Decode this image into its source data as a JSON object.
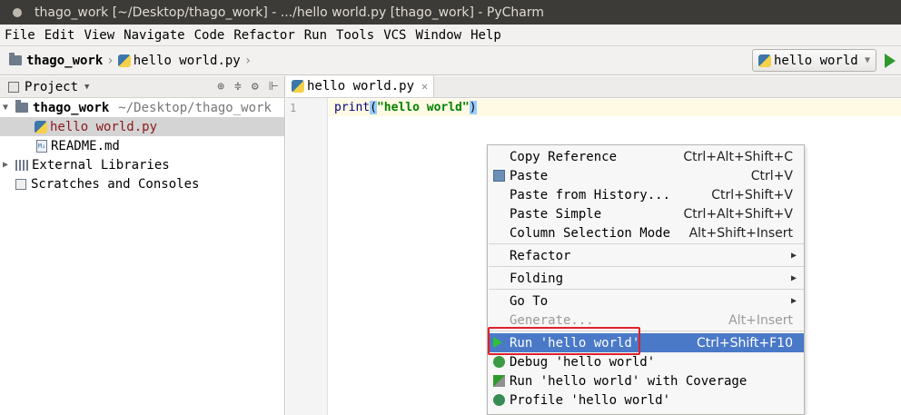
{
  "window": {
    "title": "thago_work [~/Desktop/thago_work] - .../hello world.py [thago_work] - PyCharm"
  },
  "menu": [
    "File",
    "Edit",
    "View",
    "Navigate",
    "Code",
    "Refactor",
    "Run",
    "Tools",
    "VCS",
    "Window",
    "Help"
  ],
  "navbar": {
    "project": "thago_work",
    "file": "hello world.py",
    "run_config": "hello world"
  },
  "project_panel": {
    "title": "Project",
    "root_name": "thago_work",
    "root_path": "~/Desktop/thago_work",
    "files": [
      "hello world.py",
      "README.md"
    ],
    "external_libraries": "External Libraries",
    "scratches": "Scratches and Consoles"
  },
  "editor": {
    "tab": "hello world.py",
    "line_number": "1",
    "code_fn": "print",
    "code_open": "(",
    "code_str": "\"hello world\"",
    "code_close": ")"
  },
  "context_menu": {
    "copy_reference": {
      "label": "Copy Reference",
      "shortcut": "Ctrl+Alt+Shift+C"
    },
    "paste": {
      "label": "Paste",
      "shortcut": "Ctrl+V"
    },
    "paste_history": {
      "label": "Paste from History...",
      "shortcut": "Ctrl+Shift+V"
    },
    "paste_simple": {
      "label": "Paste Simple",
      "shortcut": "Ctrl+Alt+Shift+V"
    },
    "column_mode": {
      "label": "Column Selection Mode",
      "shortcut": "Alt+Shift+Insert"
    },
    "refactor": {
      "label": "Refactor"
    },
    "folding": {
      "label": "Folding"
    },
    "go_to": {
      "label": "Go To"
    },
    "generate": {
      "label": "Generate...",
      "shortcut": "Alt+Insert"
    },
    "run": {
      "label": "Run 'hello world'",
      "shortcut": "Ctrl+Shift+F10"
    },
    "debug": {
      "label": "Debug 'hello world'"
    },
    "coverage": {
      "label": "Run 'hello world' with Coverage"
    },
    "profile": {
      "label": "Profile 'hello world'"
    }
  },
  "colors": {
    "highlight": "#4a79c8",
    "annotation_box": "#e0202a",
    "run_green": "#2e9a2e"
  }
}
